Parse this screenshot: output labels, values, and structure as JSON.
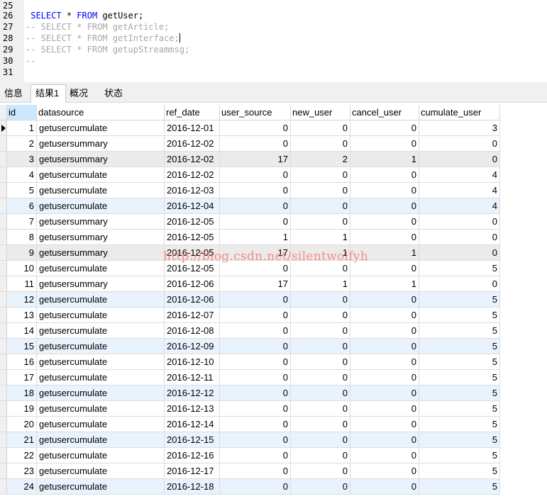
{
  "editor": {
    "lines": [
      {
        "num": "25",
        "parts": []
      },
      {
        "num": "26",
        "parts": [
          {
            "t": " ",
            "c": ""
          },
          {
            "t": "SELECT",
            "c": "kw"
          },
          {
            "t": " * ",
            "c": ""
          },
          {
            "t": "FROM",
            "c": "kw"
          },
          {
            "t": " getUser;",
            "c": ""
          }
        ]
      },
      {
        "num": "27",
        "parts": [
          {
            "t": "-- SELECT * FROM getArticle;",
            "c": "cm"
          }
        ]
      },
      {
        "num": "28",
        "parts": [
          {
            "t": "-- SELECT * FROM getInterface;",
            "c": "cm"
          }
        ],
        "cursor": true
      },
      {
        "num": "29",
        "parts": [
          {
            "t": "-- SELECT * FROM getupStreammsg;",
            "c": "cm"
          }
        ]
      },
      {
        "num": "30",
        "parts": [
          {
            "t": "--",
            "c": "cm"
          }
        ]
      },
      {
        "num": "31",
        "parts": []
      }
    ]
  },
  "tabs": [
    {
      "label": "信息",
      "active": false
    },
    {
      "label": "结果1",
      "active": true
    },
    {
      "label": "概况",
      "active": false
    },
    {
      "label": "状态",
      "active": false
    }
  ],
  "grid": {
    "columns": [
      "id",
      "datasource",
      "ref_date",
      "user_source",
      "new_user",
      "cancel_user",
      "cumulate_user"
    ],
    "rows": [
      [
        "1",
        "getusercumulate",
        "2016-12-01",
        "0",
        "0",
        "0",
        "3"
      ],
      [
        "2",
        "getusersummary",
        "2016-12-02",
        "0",
        "0",
        "0",
        "0"
      ],
      [
        "3",
        "getusersummary",
        "2016-12-02",
        "17",
        "2",
        "1",
        "0"
      ],
      [
        "4",
        "getusercumulate",
        "2016-12-02",
        "0",
        "0",
        "0",
        "4"
      ],
      [
        "5",
        "getusercumulate",
        "2016-12-03",
        "0",
        "0",
        "0",
        "4"
      ],
      [
        "6",
        "getusercumulate",
        "2016-12-04",
        "0",
        "0",
        "0",
        "4"
      ],
      [
        "7",
        "getusersummary",
        "2016-12-05",
        "0",
        "0",
        "0",
        "0"
      ],
      [
        "8",
        "getusersummary",
        "2016-12-05",
        "1",
        "1",
        "0",
        "0"
      ],
      [
        "9",
        "getusersummary",
        "2016-12-05",
        "17",
        "1",
        "1",
        "0"
      ],
      [
        "10",
        "getusercumulate",
        "2016-12-05",
        "0",
        "0",
        "0",
        "5"
      ],
      [
        "11",
        "getusersummary",
        "2016-12-06",
        "17",
        "1",
        "1",
        "0"
      ],
      [
        "12",
        "getusercumulate",
        "2016-12-06",
        "0",
        "0",
        "0",
        "5"
      ],
      [
        "13",
        "getusercumulate",
        "2016-12-07",
        "0",
        "0",
        "0",
        "5"
      ],
      [
        "14",
        "getusercumulate",
        "2016-12-08",
        "0",
        "0",
        "0",
        "5"
      ],
      [
        "15",
        "getusercumulate",
        "2016-12-09",
        "0",
        "0",
        "0",
        "5"
      ],
      [
        "16",
        "getusercumulate",
        "2016-12-10",
        "0",
        "0",
        "0",
        "5"
      ],
      [
        "17",
        "getusercumulate",
        "2016-12-11",
        "0",
        "0",
        "0",
        "5"
      ],
      [
        "18",
        "getusercumulate",
        "2016-12-12",
        "0",
        "0",
        "0",
        "5"
      ],
      [
        "19",
        "getusercumulate",
        "2016-12-13",
        "0",
        "0",
        "0",
        "5"
      ],
      [
        "20",
        "getusercumulate",
        "2016-12-14",
        "0",
        "0",
        "0",
        "5"
      ],
      [
        "21",
        "getusercumulate",
        "2016-12-15",
        "0",
        "0",
        "0",
        "5"
      ],
      [
        "22",
        "getusercumulate",
        "2016-12-16",
        "0",
        "0",
        "0",
        "5"
      ],
      [
        "23",
        "getusercumulate",
        "2016-12-17",
        "0",
        "0",
        "0",
        "5"
      ],
      [
        "24",
        "getusercumulate",
        "2016-12-18",
        "0",
        "0",
        "0",
        "5"
      ]
    ]
  },
  "watermark": "http://blog.csdn.net/silentwolfyh",
  "colors": {
    "keyword": "#0000ff",
    "comment": "#a8a8a8",
    "selected_header": "#cce8ff",
    "watermark": "#ff6a6a"
  }
}
